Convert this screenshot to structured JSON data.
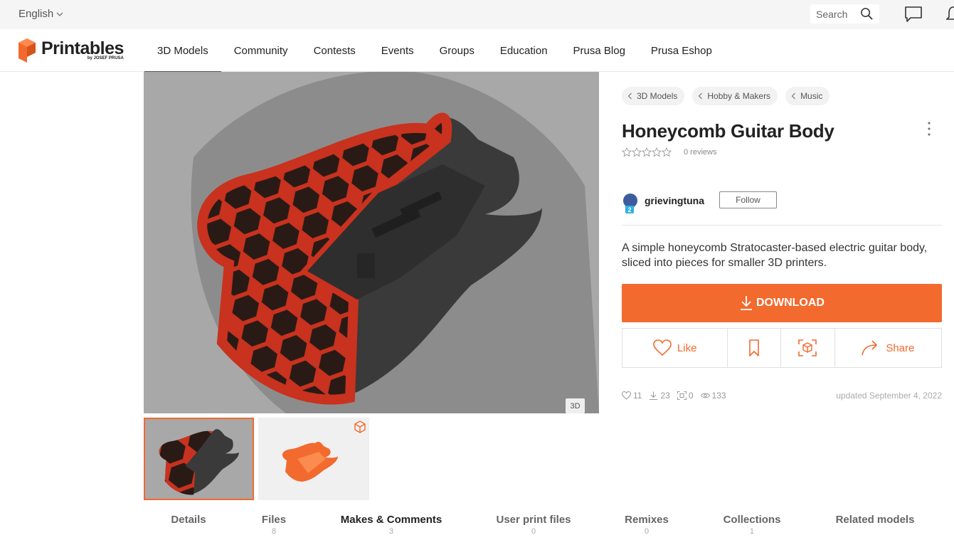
{
  "topbar": {
    "language": "English",
    "search_placeholder": "Search",
    "icons": [
      "chevron-down-icon",
      "search-icon",
      "chat-icon",
      "bell-icon"
    ]
  },
  "brand": {
    "name": "Printables",
    "sub": "by JOSEF PRUSA"
  },
  "nav": {
    "items": [
      "3D Models",
      "Community",
      "Contests",
      "Events",
      "Groups",
      "Education",
      "Prusa Blog",
      "Prusa Eshop"
    ],
    "active": "3D Models"
  },
  "viewer": {
    "badge": "3D"
  },
  "breadcrumbs": [
    "3D Models",
    "Hobby & Makers",
    "Music"
  ],
  "model": {
    "title": "Honeycomb Guitar Body",
    "rating_stars": 0,
    "reviews": "0 reviews",
    "author": "grievingtuna",
    "author_level": "2",
    "follow_label": "Follow",
    "description": "A simple honeycomb Stratocaster-based electric guitar body, sliced into pieces for smaller 3D printers."
  },
  "actions": {
    "download_label": "DOWNLOAD",
    "like_label": "Like",
    "share_label": "Share"
  },
  "stats": {
    "likes": "11",
    "downloads": "23",
    "makes": "0",
    "views": "133",
    "updated": "updated September 4, 2022"
  },
  "tabs": [
    {
      "label": "Details",
      "count": ""
    },
    {
      "label": "Files",
      "count": "8"
    },
    {
      "label": "Makes & Comments",
      "count": "3"
    },
    {
      "label": "User print files",
      "count": "0"
    },
    {
      "label": "Remixes",
      "count": "0"
    },
    {
      "label": "Collections",
      "count": "1"
    },
    {
      "label": "Related models",
      "count": ""
    }
  ],
  "colors": {
    "accent": "#f26a2e",
    "model_red": "#c8321e",
    "model_black": "#3a3a3a",
    "viewer_bg": "#a8a8a8"
  }
}
